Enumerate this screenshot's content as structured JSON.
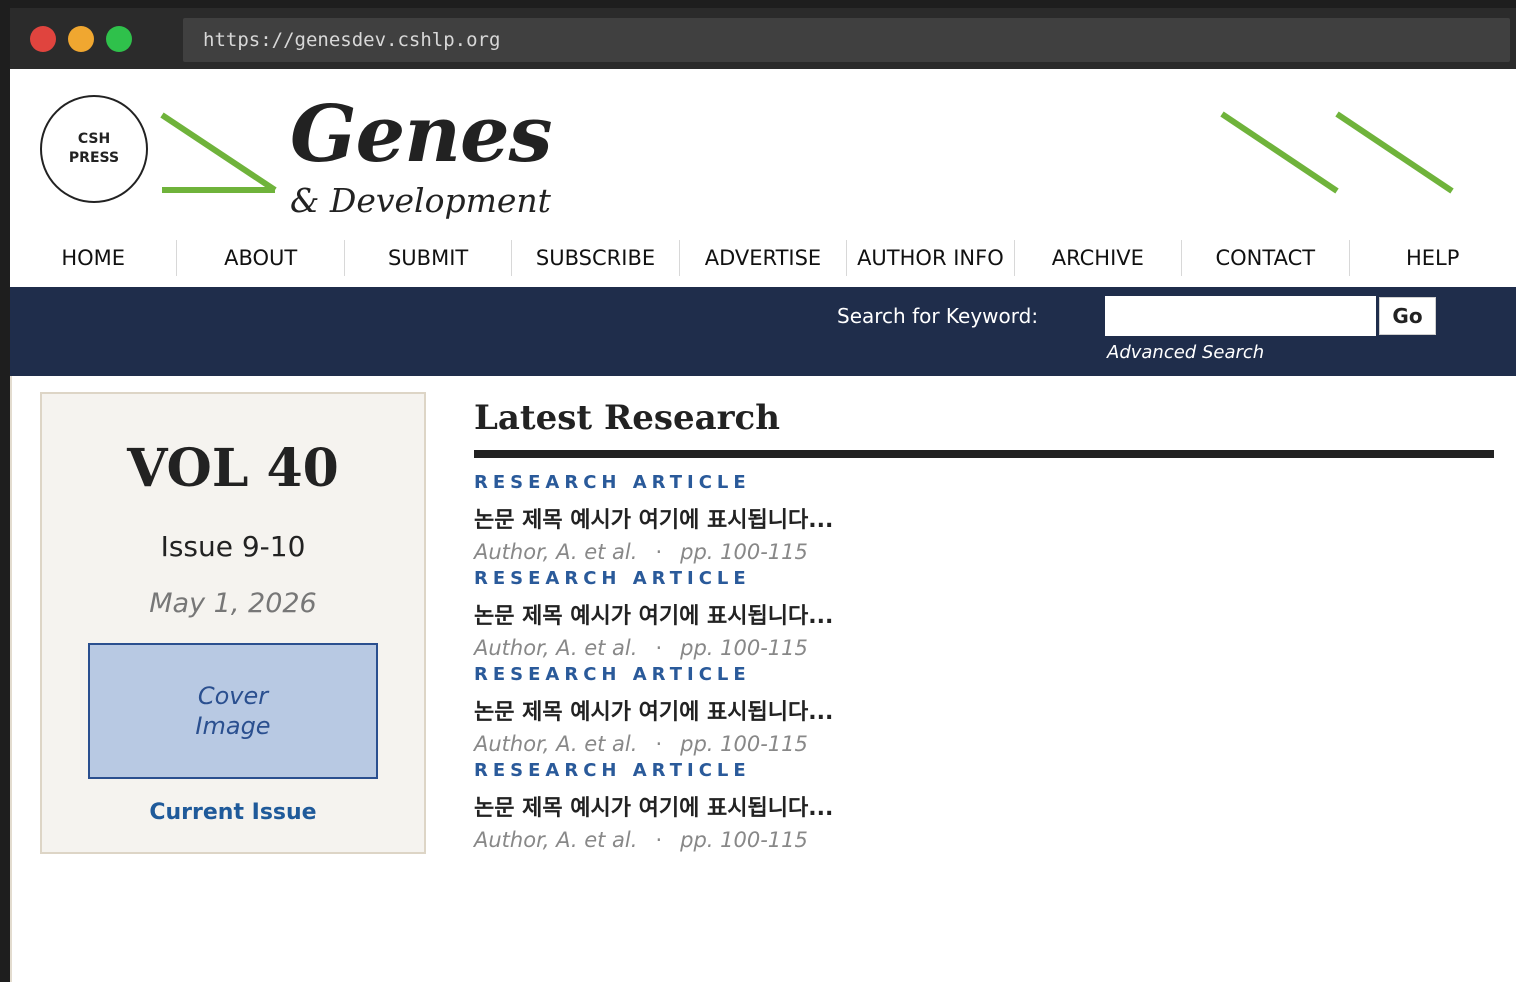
{
  "browser": {
    "url": "https://genesdev.cshlp.org"
  },
  "header": {
    "logo_text": [
      "CSH",
      "PRESS"
    ],
    "title_main": "Genes",
    "title_sub": "& Development",
    "accent_color": "#6fb33b"
  },
  "nav": {
    "items": [
      {
        "label": "HOME"
      },
      {
        "label": "ABOUT"
      },
      {
        "label": "SUBMIT"
      },
      {
        "label": "SUBSCRIBE"
      },
      {
        "label": "ADVERTISE"
      },
      {
        "label": "AUTHOR INFO"
      },
      {
        "label": "ARCHIVE"
      },
      {
        "label": "CONTACT"
      },
      {
        "label": "HELP"
      }
    ]
  },
  "search": {
    "label": "Search for Keyword:",
    "value": "",
    "button": "Go",
    "advanced": "Advanced Search",
    "bar_color": "#1f2d4b"
  },
  "issue": {
    "volume": "VOL 40",
    "number": "Issue 9-10",
    "date": "May 1, 2026",
    "cover_label": "Cover Image",
    "current_link": "Current Issue"
  },
  "latest": {
    "heading": "Latest Research",
    "articles": [
      {
        "type": "RESEARCH ARTICLE",
        "title": "논문 제목 예시가 여기에 표시됩니다...",
        "authors": "Author, A. et al.",
        "pages": "pp. 100-115"
      },
      {
        "type": "RESEARCH ARTICLE",
        "title": "논문 제목 예시가 여기에 표시됩니다...",
        "authors": "Author, A. et al.",
        "pages": "pp. 100-115"
      },
      {
        "type": "RESEARCH ARTICLE",
        "title": "논문 제목 예시가 여기에 표시됩니다...",
        "authors": "Author, A. et al.",
        "pages": "pp. 100-115"
      },
      {
        "type": "RESEARCH ARTICLE",
        "title": "논문 제목 예시가 여기에 표시됩니다...",
        "authors": "Author, A. et al.",
        "pages": "pp. 100-115"
      }
    ]
  }
}
